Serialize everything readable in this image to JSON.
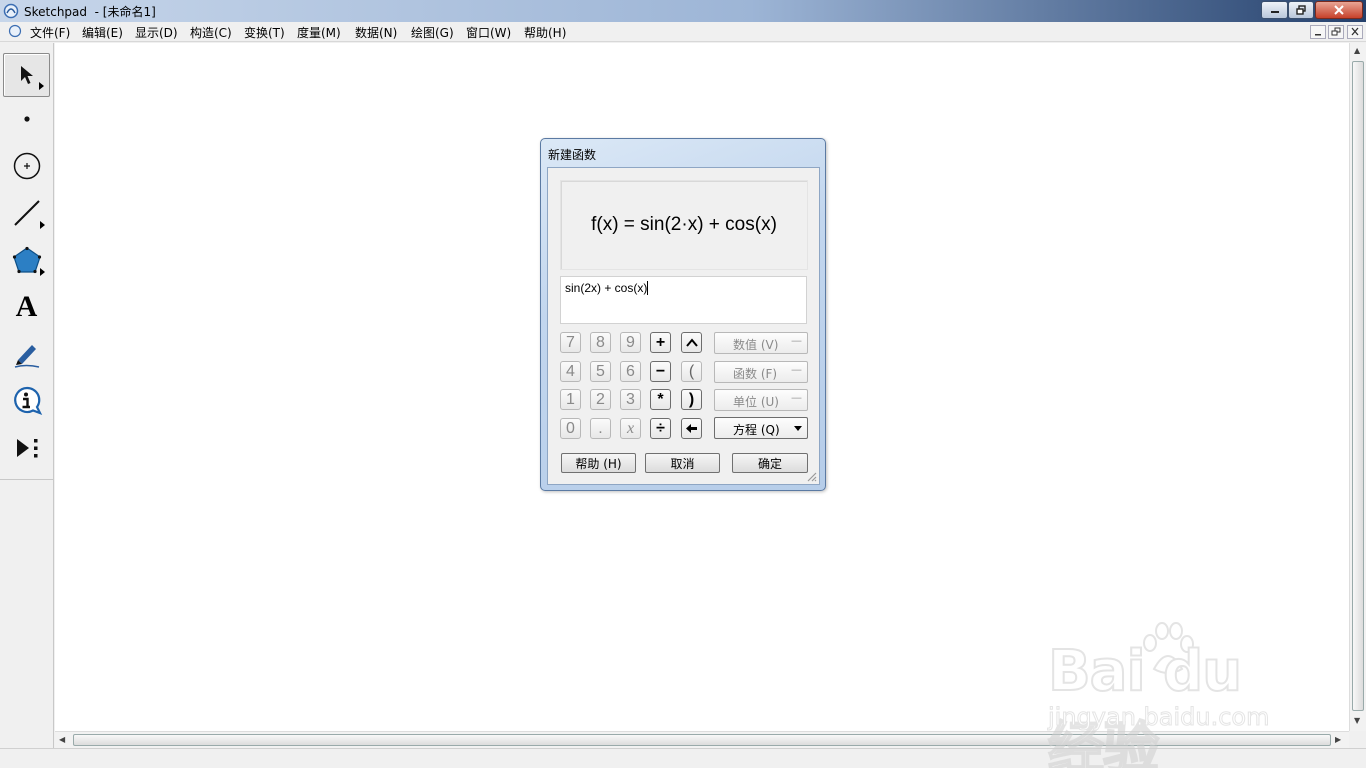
{
  "window": {
    "title": "Sketchpad  - [未命名1]"
  },
  "menu": [
    "文件(F)",
    "编辑(E)",
    "显示(D)",
    "构造(C)",
    "变换(T)",
    "度量(M)",
    "数据(N)",
    "绘图(G)",
    "窗口(W)",
    "帮助(H)"
  ],
  "toolbox": {
    "text_tool_glyph": "A"
  },
  "dialog": {
    "title": "新建函数",
    "preview_formula": "f(x) = sin(2·x) + cos(x)",
    "expression_value": "sin(2x) + cos(x)",
    "keypad": {
      "row1": [
        "7",
        "8",
        "9",
        "+",
        "^"
      ],
      "row2": [
        "4",
        "5",
        "6",
        "−",
        "("
      ],
      "row3": [
        "1",
        "2",
        "3",
        "*",
        ")"
      ],
      "row4": [
        "0",
        ".",
        "x",
        "÷",
        "←"
      ]
    },
    "popups": {
      "values": "数值 (V)",
      "functions": "函数 (F)",
      "units": "单位 (U)",
      "equation": "方程 (Q)",
      "minus_mark": "—"
    },
    "buttons": {
      "help": "帮助 (H)",
      "cancel": "取消",
      "ok": "确定"
    }
  },
  "watermark": {
    "brand": "Bai du 经验",
    "url": "jingyan.baidu.com"
  }
}
